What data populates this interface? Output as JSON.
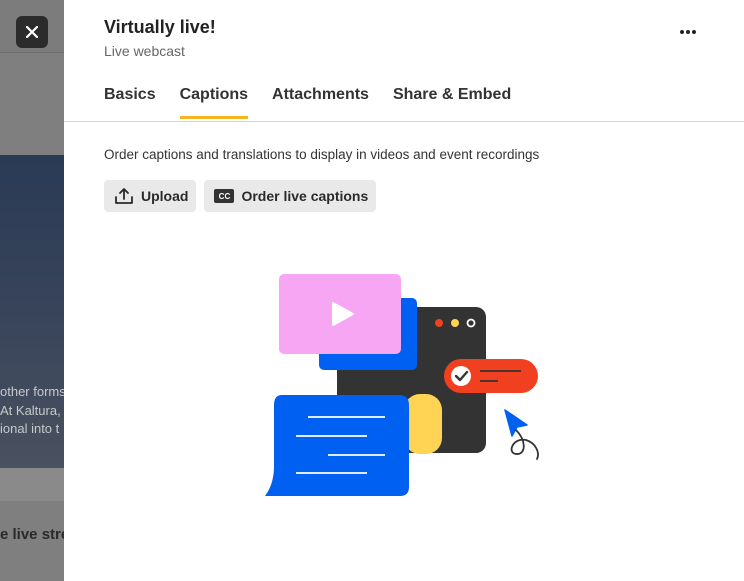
{
  "background": {
    "text_lines": [
      "other forms",
      "At Kaltura,",
      "ional into t"
    ],
    "bold_text": "e live strea"
  },
  "close_icon": "close-icon",
  "panel": {
    "title": "Virtually live!",
    "subtitle": "Live webcast",
    "more_icon": "more-horizontal-icon",
    "tabs": [
      {
        "label": "Basics",
        "active": false
      },
      {
        "label": "Captions",
        "active": true
      },
      {
        "label": "Attachments",
        "active": false
      },
      {
        "label": "Share & Embed",
        "active": false
      }
    ],
    "description": "Order captions and translations to display in videos and event recordings",
    "buttons": {
      "upload": {
        "label": "Upload",
        "icon": "upload-icon"
      },
      "order_captions": {
        "label": "Order live captions",
        "icon": "cc-icon",
        "icon_text": "CC"
      }
    }
  },
  "colors": {
    "accent_tab": "#f5b51f",
    "illus_pink": "#f7a6f4",
    "illus_blue": "#0060f2",
    "illus_dark": "#333333",
    "illus_red": "#f1401f",
    "illus_yellow": "#ffd354"
  }
}
